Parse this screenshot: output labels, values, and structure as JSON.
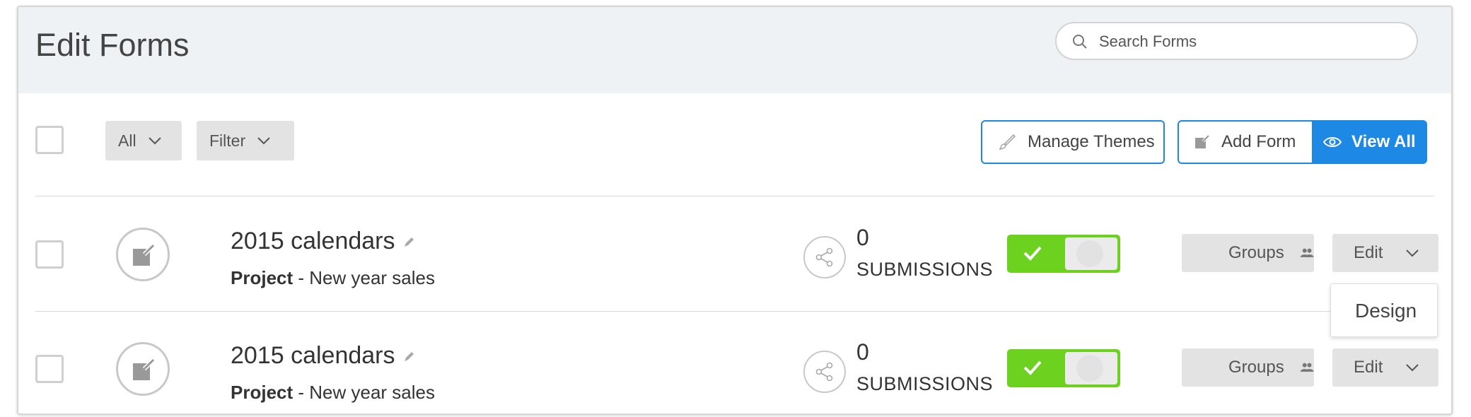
{
  "header": {
    "title": "Edit Forms",
    "search": {
      "placeholder": "Search Forms",
      "value": "",
      "icon": "search-icon"
    }
  },
  "toolbar": {
    "all_label": "All",
    "filter_label": "Filter",
    "manage_themes_label": "Manage Themes",
    "add_form_label": "Add Form",
    "view_all_label": "View All",
    "accent_color": "#1e88e5"
  },
  "forms": [
    {
      "name": "2015 calendars",
      "meta_bold": "Project",
      "meta_rest": " - New year sales",
      "submission_count": "0",
      "submission_label": "SUBMISSIONS",
      "enabled": true,
      "groups_label": "Groups",
      "edit_label": "Edit"
    },
    {
      "name": "2015 calendars",
      "meta_bold": "Project",
      "meta_rest": " - New year sales",
      "submission_count": "0",
      "submission_label": "SUBMISSIONS",
      "enabled": true,
      "groups_label": "Groups",
      "edit_label": "Edit"
    }
  ],
  "edit_dropdown": {
    "items": [
      "Design"
    ]
  },
  "colors": {
    "toggle_on": "#6cd11f",
    "header_bg": "#eef2f5",
    "button_gray": "#e3e3e3"
  }
}
